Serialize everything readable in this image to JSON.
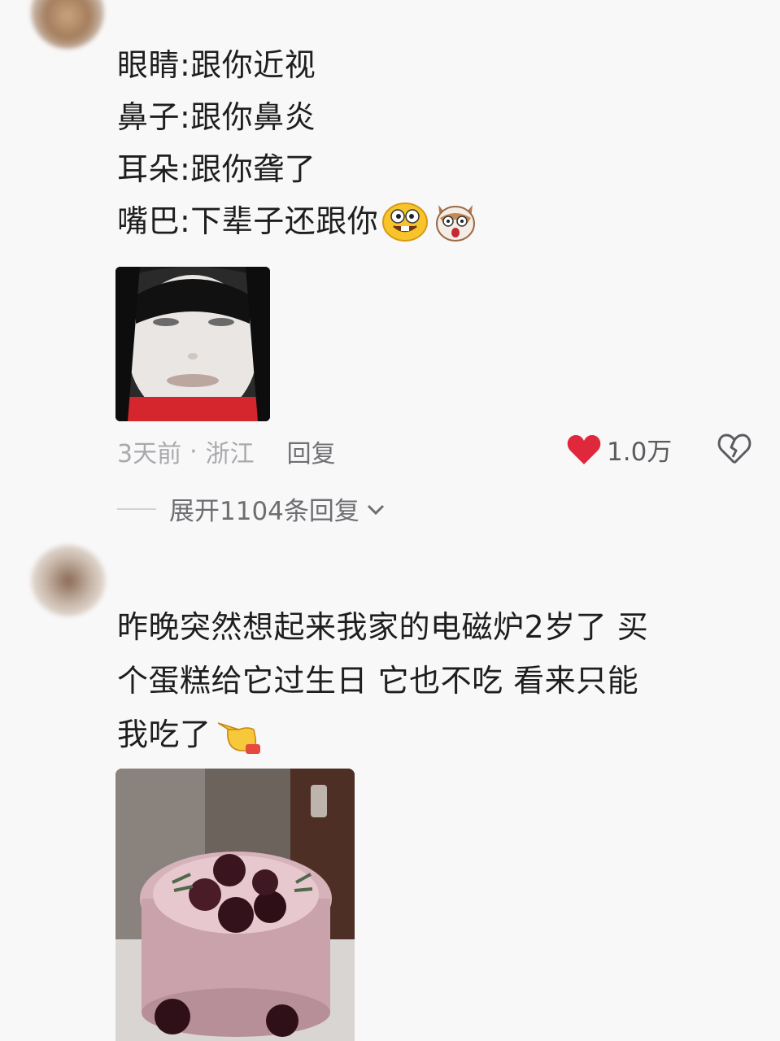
{
  "comment1": {
    "lines": [
      "眼睛:跟你近视",
      "鼻子:跟你鼻炎",
      "耳朵:跟你聋了",
      "嘴巴:下辈子还跟你"
    ],
    "emojis": [
      "grinning-buck-tooth-emoji",
      "shocked-dog-emoji"
    ],
    "attached_image": "white-face-meme-image",
    "time": "3天前",
    "separator": "·",
    "location": "浙江",
    "reply_label": "回复",
    "like_count": "1.0万",
    "like_color": "#e0283d",
    "expand_replies": "展开1104条回复"
  },
  "comment2": {
    "lines": [
      "昨晚突然想起来我家的电磁炉2岁了 买",
      "个蛋糕给它过生日 它也不吃 看来只能",
      "我吃了"
    ],
    "emojis": [
      "pointing-hand-emoji"
    ],
    "attached_image": "berry-cake-photo"
  }
}
